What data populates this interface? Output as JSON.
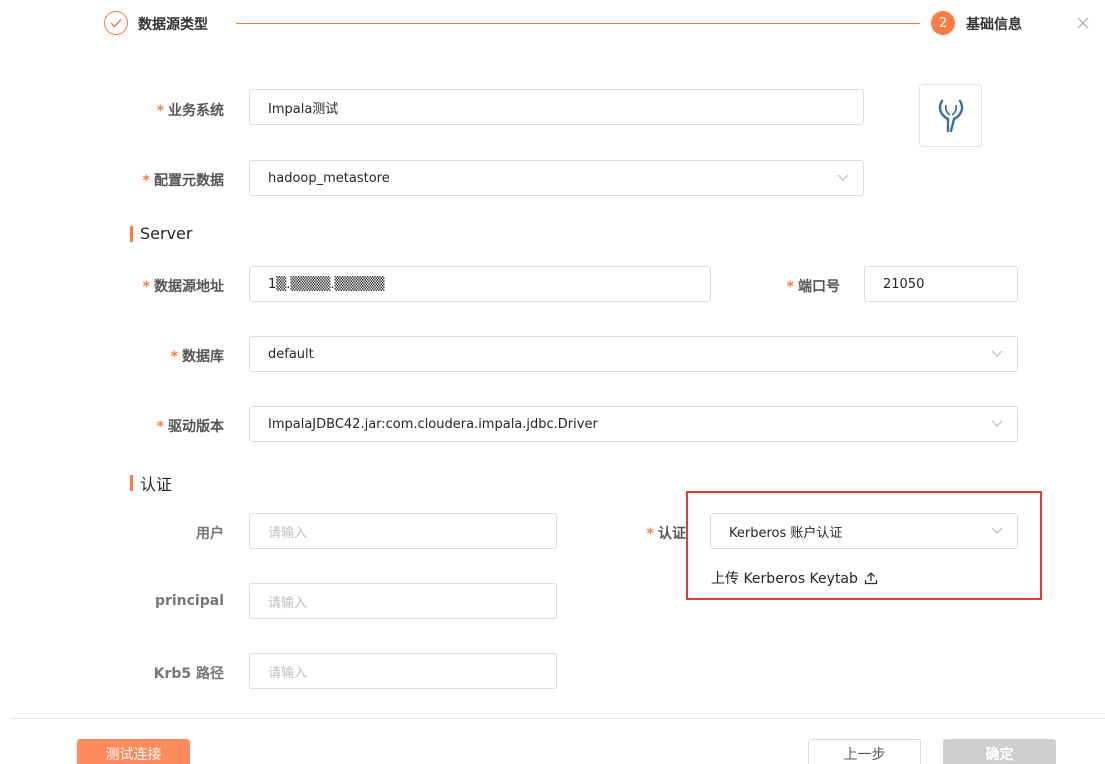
{
  "steps": {
    "step1_title": "数据源类型",
    "step2_number": "2",
    "step2_title": "基础信息"
  },
  "form": {
    "business_system": {
      "label": "业务系统",
      "value": "Impala测试"
    },
    "config_metadata": {
      "label": "配置元数据",
      "value": "hadoop_metastore"
    },
    "server_section": "Server",
    "datasource_address": {
      "label": "数据源地址",
      "value": "1▒.▒▒▒▒.▒▒▒▒▒"
    },
    "port": {
      "label": "端口号",
      "value": "21050"
    },
    "database": {
      "label": "数据库",
      "value": "default"
    },
    "driver_version": {
      "label": "驱动版本",
      "value": "ImpalaJDBC42.jar:com.cloudera.impala.jdbc.Driver"
    },
    "auth_section": "认证",
    "user": {
      "label": "用户",
      "placeholder": "请输入"
    },
    "principal": {
      "label": "principal",
      "placeholder": "请输入"
    },
    "krb5_path": {
      "label": "Krb5 路径",
      "placeholder": "请输入"
    },
    "auth": {
      "label": "认证",
      "value": "Kerberos 账户认证"
    },
    "upload_keytab": "上传 Kerberos Keytab"
  },
  "required_mark": "*",
  "buttons": {
    "test_connection": "测试连接",
    "previous": "上一步",
    "confirm": "确定"
  },
  "colors": {
    "accent": "#ff7a45",
    "highlight_border": "#e53935",
    "disabled_button": "#cfcfcf"
  },
  "icons": {
    "step_done": "check-circle-icon",
    "close": "close-icon",
    "dropdown": "chevron-down-icon",
    "upload": "upload-icon",
    "logo": "impala-logo-icon"
  }
}
